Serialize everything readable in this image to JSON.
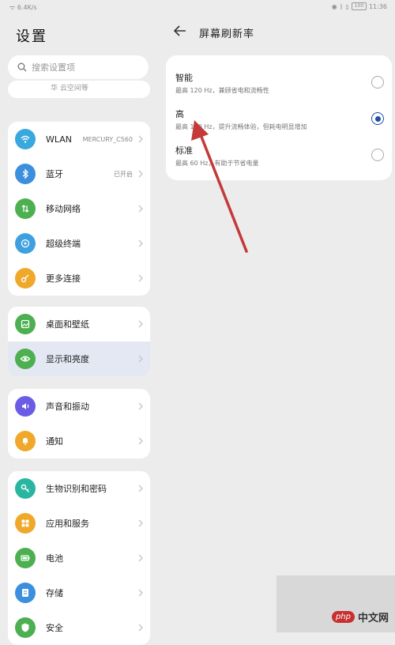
{
  "status_bar": {
    "carrier": "ᯤ 6.4K/s",
    "time": "11:36",
    "battery": "100"
  },
  "left": {
    "title": "设置",
    "search_placeholder": "搜索设置项",
    "cut_text": "华  云空间等",
    "groups": [
      [
        {
          "label": "WLAN",
          "value": "MERCURY_C560",
          "icon": "wifi-icon",
          "color": "#39a8de"
        },
        {
          "label": "蓝牙",
          "value": "已开启",
          "icon": "bluetooth-icon",
          "color": "#3c8fdc"
        },
        {
          "label": "移动网络",
          "value": "",
          "icon": "signal-icon",
          "color": "#4caf50"
        },
        {
          "label": "超级终端",
          "value": "",
          "icon": "super-device-icon",
          "color": "#3fa0e0"
        },
        {
          "label": "更多连接",
          "value": "",
          "icon": "link-icon",
          "color": "#f0a82b"
        }
      ],
      [
        {
          "label": "桌面和壁纸",
          "value": "",
          "icon": "wallpaper-icon",
          "color": "#4caf50"
        },
        {
          "label": "显示和亮度",
          "value": "",
          "icon": "eye-icon",
          "color": "#4caf50"
        }
      ],
      [
        {
          "label": "声音和振动",
          "value": "",
          "icon": "sound-icon",
          "color": "#6b5ce6"
        },
        {
          "label": "通知",
          "value": "",
          "icon": "bell-icon",
          "color": "#f0a82b"
        }
      ],
      [
        {
          "label": "生物识别和密码",
          "value": "",
          "icon": "key-icon",
          "color": "#29b6a0"
        },
        {
          "label": "应用和服务",
          "value": "",
          "icon": "apps-icon",
          "color": "#f0a82b"
        },
        {
          "label": "电池",
          "value": "",
          "icon": "battery-icon",
          "color": "#4caf50"
        },
        {
          "label": "存储",
          "value": "",
          "icon": "storage-icon",
          "color": "#3c8fdc"
        },
        {
          "label": "安全",
          "value": "",
          "icon": "shield-icon",
          "color": "#4caf50"
        }
      ]
    ]
  },
  "right": {
    "title": "屏幕刷新率",
    "options": [
      {
        "title": "智能",
        "desc": "最高 120 Hz，兼顾省电和流畅性",
        "selected": false
      },
      {
        "title": "高",
        "desc": "最高 120 Hz，提升流畅体验，但耗电明显增加",
        "selected": true
      },
      {
        "title": "标准",
        "desc": "最高 60 Hz，有助于节省电量",
        "selected": false
      }
    ]
  },
  "watermark": {
    "logo": "php",
    "text": "中文网"
  },
  "colors": {
    "accent": "#1f4ea8",
    "arrow": "#c4393a"
  }
}
